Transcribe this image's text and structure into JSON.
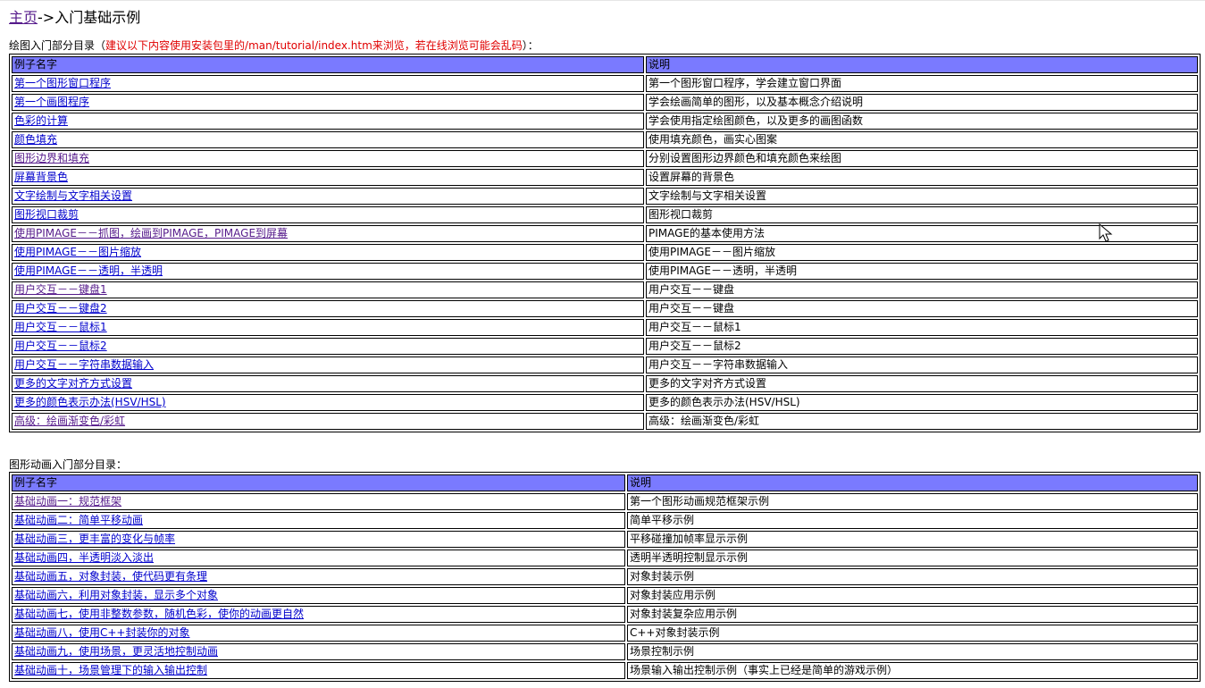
{
  "breadcrumb": {
    "home_link": "主页",
    "separator": "->",
    "current": "入门基础示例"
  },
  "drawing_section": {
    "heading": "绘图入门部分目录",
    "heading_open": "（",
    "note": "建议以下内容使用安装包里的/man/tutorial/index.htm来浏览，若在线浏览可能会乱码",
    "heading_close": "）：",
    "columns": [
      "例子名字",
      "说明"
    ],
    "rows": [
      {
        "name": "第一个图形窗口程序",
        "desc": "第一个图形窗口程序，学会建立窗口界面",
        "visited": false
      },
      {
        "name": "第一个画图程序",
        "desc": "学会绘画简单的图形，以及基本概念介绍说明",
        "visited": false
      },
      {
        "name": "色彩的计算",
        "desc": "学会使用指定绘图颜色，以及更多的画图函数",
        "visited": false
      },
      {
        "name": "颜色填充",
        "desc": "使用填充颜色，画实心图案",
        "visited": false
      },
      {
        "name": "图形边界和填充",
        "desc": "分别设置图形边界颜色和填充颜色来绘图",
        "visited": true
      },
      {
        "name": "屏幕背景色",
        "desc": "设置屏幕的背景色",
        "visited": false
      },
      {
        "name": "文字绘制与文字相关设置",
        "desc": "文字绘制与文字相关设置",
        "visited": false
      },
      {
        "name": "图形视口裁剪",
        "desc": "图形视口裁剪",
        "visited": false
      },
      {
        "name": "使用PIMAGE－－抓图，绘画到PIMAGE，PIMAGE到屏幕",
        "desc": "PIMAGE的基本使用方法",
        "visited": true
      },
      {
        "name": "使用PIMAGE－－图片缩放",
        "desc": "使用PIMAGE－－图片缩放",
        "visited": false
      },
      {
        "name": "使用PIMAGE－－透明，半透明",
        "desc": "使用PIMAGE－－透明，半透明",
        "visited": false
      },
      {
        "name": "用户交互－－键盘1",
        "desc": "用户交互－－键盘",
        "visited": true
      },
      {
        "name": "用户交互－－键盘2",
        "desc": "用户交互－－键盘",
        "visited": false
      },
      {
        "name": "用户交互－－鼠标1",
        "desc": "用户交互－－鼠标1",
        "visited": false
      },
      {
        "name": "用户交互－－鼠标2",
        "desc": "用户交互－－鼠标2",
        "visited": false
      },
      {
        "name": "用户交互－－字符串数据输入",
        "desc": "用户交互－－字符串数据输入",
        "visited": false
      },
      {
        "name": "更多的文字对齐方式设置",
        "desc": "更多的文字对齐方式设置",
        "visited": false
      },
      {
        "name": "更多的颜色表示办法(HSV/HSL)",
        "desc": "更多的颜色表示办法(HSV/HSL)",
        "visited": false
      },
      {
        "name": "高级：绘画渐变色/彩虹",
        "desc": "高级：绘画渐变色/彩虹",
        "visited": true
      }
    ]
  },
  "animation_section": {
    "heading": "图形动画入门部分目录：",
    "columns": [
      "例子名字",
      "说明"
    ],
    "rows": [
      {
        "name": "基础动画一：规范框架",
        "desc": "第一个图形动画规范框架示例",
        "visited": true
      },
      {
        "name": "基础动画二：简单平移动画",
        "desc": "简单平移示例",
        "visited": false
      },
      {
        "name": "基础动画三，更丰富的变化与帧率",
        "desc": "平移碰撞加帧率显示示例",
        "visited": false
      },
      {
        "name": "基础动画四，半透明淡入淡出",
        "desc": "透明半透明控制显示示例",
        "visited": false
      },
      {
        "name": "基础动画五，对象封装，使代码更有条理",
        "desc": "对象封装示例",
        "visited": false
      },
      {
        "name": "基础动画六，利用对象封装，显示多个对象",
        "desc": "对象封装应用示例",
        "visited": false
      },
      {
        "name": "基础动画七，使用非整数参数，随机色彩，使你的动画更自然",
        "desc": "对象封装复杂应用示例",
        "visited": false
      },
      {
        "name": "基础动画八，使用C++封装你的对象",
        "desc": "C++对象封装示例",
        "visited": false
      },
      {
        "name": "基础动画九，使用场景，更灵活地控制动画",
        "desc": "场景控制示例",
        "visited": false
      },
      {
        "name": "基础动画十，场景管理下的输入输出控制",
        "desc": "场景输入输出控制示例（事实上已经是简单的游戏示例）",
        "visited": false
      }
    ]
  },
  "colors": {
    "header_bg": "#7a7aff",
    "link": "#0000cc",
    "visited_link": "#551a8b",
    "note": "#e00000"
  },
  "icons": {
    "cursor": "mouse-pointer-icon"
  }
}
